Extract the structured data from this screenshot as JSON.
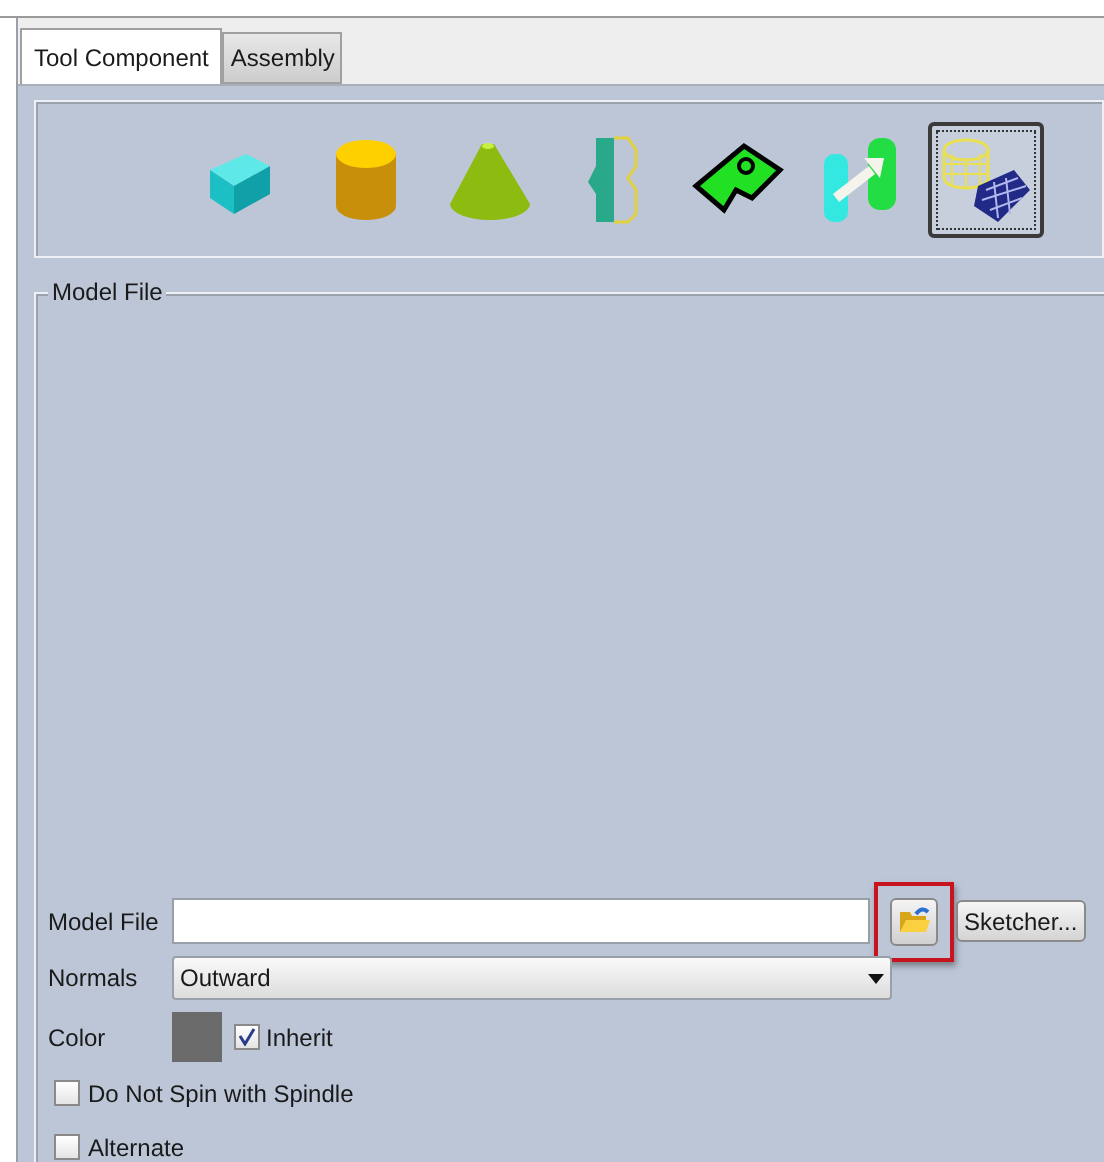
{
  "tabs": [
    {
      "label": "Tool Component",
      "selected": true
    },
    {
      "label": "Assembly",
      "selected": false
    }
  ],
  "toolbar": [
    {
      "kind": "box",
      "selected": false
    },
    {
      "kind": "cylinder",
      "selected": false
    },
    {
      "kind": "cone",
      "selected": false
    },
    {
      "kind": "profile",
      "selected": false
    },
    {
      "kind": "part",
      "selected": false
    },
    {
      "kind": "transform",
      "selected": false
    },
    {
      "kind": "mesh",
      "selected": true
    }
  ],
  "group": {
    "title": "Model File"
  },
  "model_file": {
    "label": "Model File",
    "browse_highlighted": true,
    "sketcher": "Sketcher..."
  },
  "normals": {
    "label": "Normals",
    "value": "Outward"
  },
  "color": {
    "label": "Color",
    "color": "#6b6b6b",
    "inherit": {
      "label": "Inherit",
      "checked": true
    }
  },
  "options": [
    {
      "label": "Do Not Spin with Spindle",
      "checked": false
    },
    {
      "label": "Alternate",
      "checked": false
    }
  ]
}
